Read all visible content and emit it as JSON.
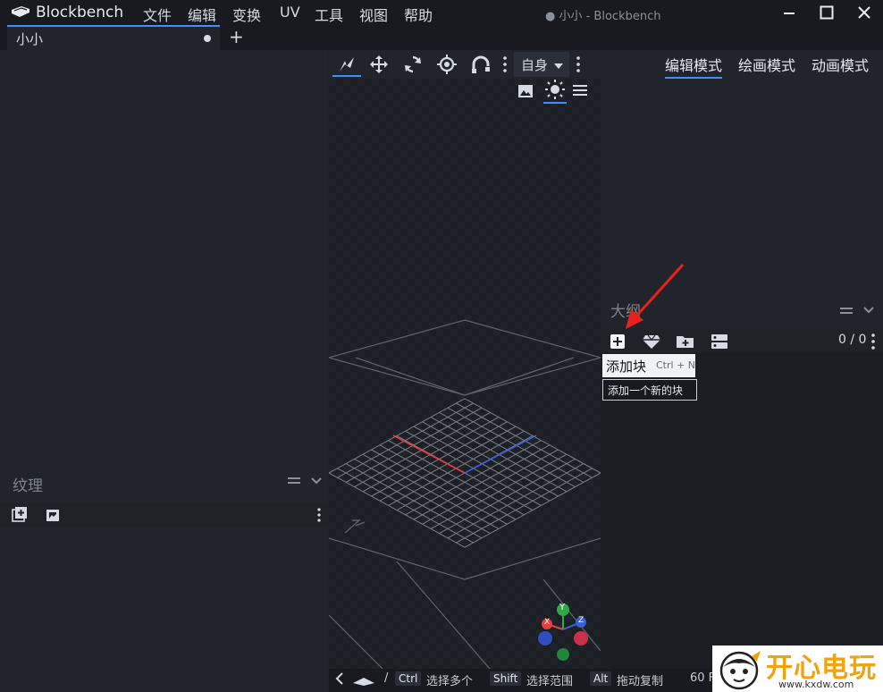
{
  "app": {
    "name": "Blockbench",
    "window_title": "● 小小 - Blockbench"
  },
  "menu": [
    "文件",
    "编辑",
    "变换",
    "UV",
    "工具",
    "视图",
    "帮助"
  ],
  "window_controls": [
    "minimize-icon",
    "maximize-icon",
    "close-icon"
  ],
  "tabs": [
    {
      "label": "小小",
      "unsaved": true
    }
  ],
  "viewport_toolbar": {
    "tools": [
      "selection-icon",
      "move-icon",
      "rotate-icon",
      "pivot-icon",
      "vertex-snap-icon"
    ],
    "space_label": "自身",
    "view_icons": [
      "background-icon",
      "lighting-icon",
      "menu-icon"
    ]
  },
  "modes": {
    "edit": "编辑模式",
    "paint": "绘画模式",
    "animate": "动画模式"
  },
  "outliner": {
    "title": "大纲",
    "count": "0 / 0",
    "tools": [
      "add-cube-icon",
      "add-mesh-icon",
      "add-group-icon",
      "toggle-options-icon"
    ]
  },
  "tooltip": {
    "title": "添加块",
    "shortcut": "Ctrl + N",
    "description": "添加一个新的块"
  },
  "textures": {
    "title": "纹理",
    "tools": [
      "import-texture-icon",
      "create-texture-icon"
    ]
  },
  "statusbar": {
    "hints": [
      {
        "key": "Ctrl",
        "desc": "选择多个"
      },
      {
        "key": "Shift",
        "desc": "选择范围"
      },
      {
        "key": "Alt",
        "desc": "拖动复制"
      }
    ],
    "fps": "60 F",
    "slash": "/"
  },
  "axis_gizmo": {
    "x": "X",
    "y": "Y",
    "z": "Z"
  },
  "watermark": {
    "text": "开心电玩",
    "url": "www.kxdw.com"
  },
  "colors": {
    "accent": "#3e90ff",
    "x_axis": "#e84040",
    "y_axis": "#2fa84a",
    "z_axis": "#3a5fd9",
    "arrow": "#e8221b"
  }
}
